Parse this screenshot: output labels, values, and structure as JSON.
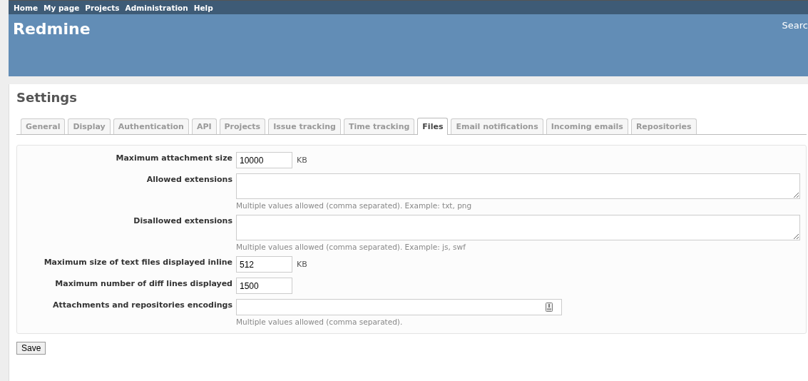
{
  "top_menu": [
    "Home",
    "My page",
    "Projects",
    "Administration",
    "Help"
  ],
  "header": {
    "title": "Redmine",
    "search_label": "Searc"
  },
  "page_title": "Settings",
  "tabs": [
    {
      "label": "General",
      "selected": false
    },
    {
      "label": "Display",
      "selected": false
    },
    {
      "label": "Authentication",
      "selected": false
    },
    {
      "label": "API",
      "selected": false
    },
    {
      "label": "Projects",
      "selected": false
    },
    {
      "label": "Issue tracking",
      "selected": false
    },
    {
      "label": "Time tracking",
      "selected": false
    },
    {
      "label": "Files",
      "selected": true
    },
    {
      "label": "Email notifications",
      "selected": false
    },
    {
      "label": "Incoming emails",
      "selected": false
    },
    {
      "label": "Repositories",
      "selected": false
    }
  ],
  "fields": [
    {
      "kind": "short",
      "label": "Maximum attachment size",
      "value": "10000",
      "unit": "KB"
    },
    {
      "kind": "textarea",
      "label": "Allowed extensions",
      "hint": "Multiple values allowed (comma separated). Example: txt, png"
    },
    {
      "kind": "textarea",
      "label": "Disallowed extensions",
      "hint": "Multiple values allowed (comma separated). Example: js, swf"
    },
    {
      "kind": "short",
      "label": "Maximum size of text files displayed inline",
      "value": "512",
      "unit": "KB"
    },
    {
      "kind": "short",
      "label": "Maximum number of diff lines displayed",
      "value": "1500"
    },
    {
      "kind": "wide",
      "label": "Attachments and repositories encodings",
      "hint": "Multiple values allowed (comma separated)."
    }
  ],
  "save_button": "Save"
}
